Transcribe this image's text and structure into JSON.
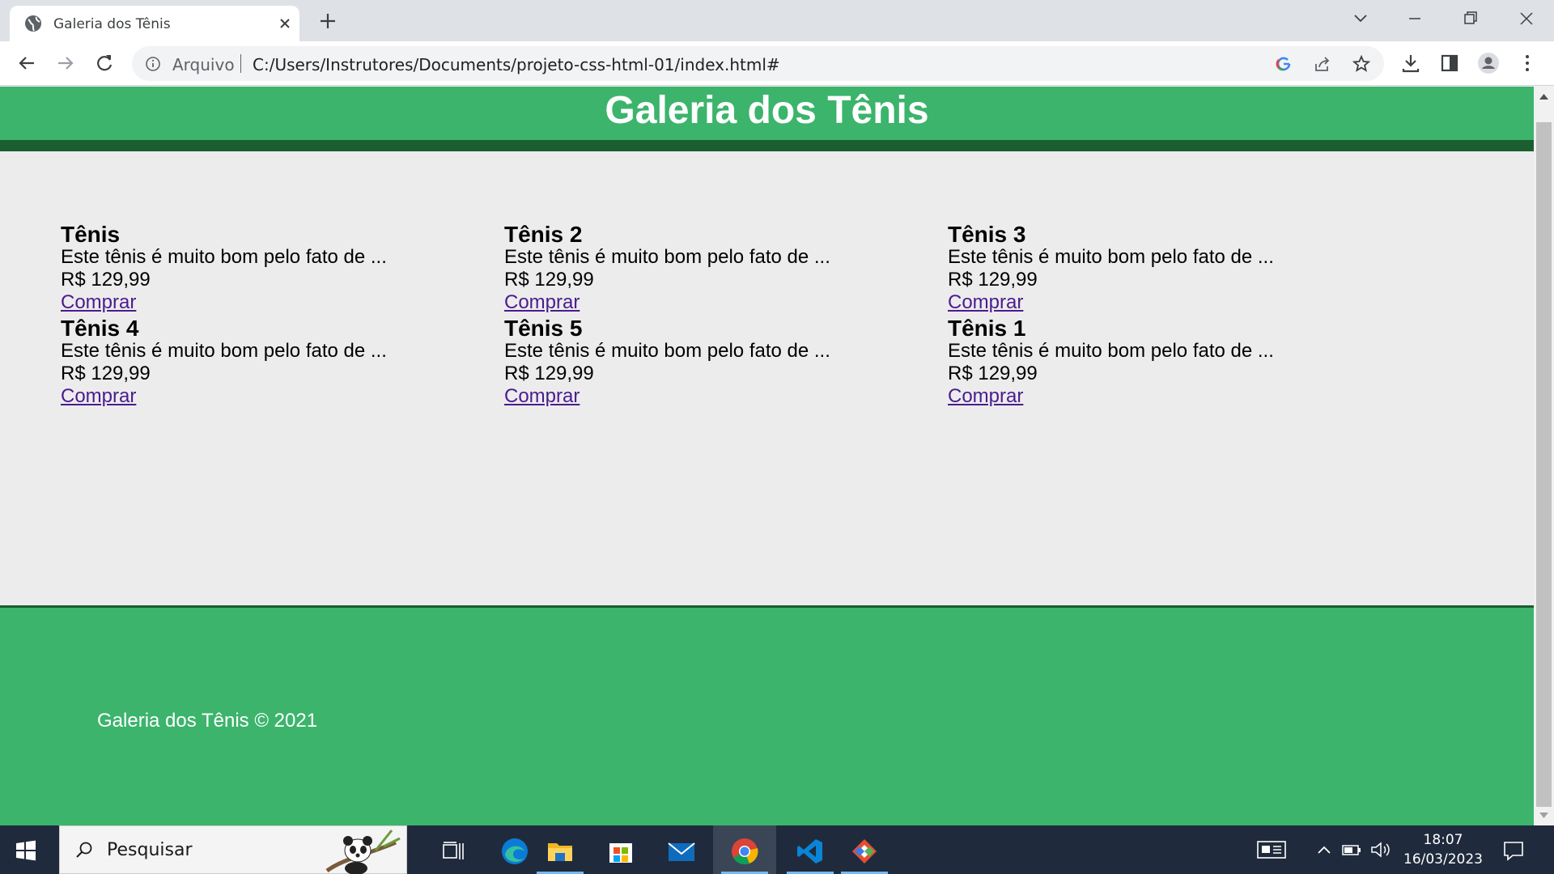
{
  "browser": {
    "tab_title": "Galeria dos Tênis",
    "scheme_label": "Arquivo",
    "url": "C:/Users/Instrutores/Documents/projeto-css-html-01/index.html#"
  },
  "page": {
    "title": "Galeria dos Tênis",
    "products": [
      {
        "name": "Tênis",
        "description": "Este tênis é muito bom pelo fato de ...",
        "price": "R$ 129,99",
        "buy_label": "Comprar"
      },
      {
        "name": "Tênis 2",
        "description": "Este tênis é muito bom pelo fato de ...",
        "price": "R$ 129,99",
        "buy_label": "Comprar"
      },
      {
        "name": "Tênis 3",
        "description": "Este tênis é muito bom pelo fato de ...",
        "price": "R$ 129,99",
        "buy_label": "Comprar"
      },
      {
        "name": "Tênis 4",
        "description": "Este tênis é muito bom pelo fato de ...",
        "price": "R$ 129,99",
        "buy_label": "Comprar"
      },
      {
        "name": "Tênis 5",
        "description": "Este tênis é muito bom pelo fato de ...",
        "price": "R$ 129,99",
        "buy_label": "Comprar"
      },
      {
        "name": "Tênis 1",
        "description": "Este tênis é muito bom pelo fato de ...",
        "price": "R$ 129,99",
        "buy_label": "Comprar"
      }
    ],
    "footer": "Galeria dos Tênis © 2021"
  },
  "taskbar": {
    "search_placeholder": "Pesquisar",
    "time": "18:07",
    "date": "16/03/2023",
    "apps": [
      "task-view",
      "edge",
      "file-explorer",
      "store",
      "mail",
      "chrome",
      "vscode",
      "git"
    ]
  },
  "colors": {
    "header_green": "#3cb46c",
    "header_border": "#1b5e30",
    "link_purple": "#4b1b8f",
    "page_bg": "#ececec",
    "taskbar_bg": "#1f2b3c"
  }
}
